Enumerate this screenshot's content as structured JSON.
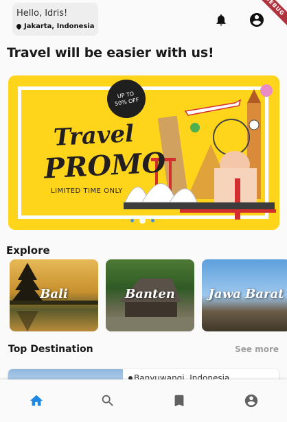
{
  "header": {
    "greeting": "Hello, Idris!",
    "location": "Jakarta, Indonesia",
    "notification_icon": "bell-icon",
    "profile_icon": "account-circle-icon",
    "debug_banner": "DEBUG"
  },
  "headline": "Travel will be easier with us!",
  "banner": {
    "badge_line1": "UP TO",
    "badge_line2": "50% OFF",
    "title_line1": "Travel",
    "title_line2": "PROMO",
    "subtitle": "LIMITED TIME ONLY",
    "slide_count": 3,
    "active_slide": 2
  },
  "explore": {
    "title": "Explore",
    "items": [
      {
        "label": "Bali"
      },
      {
        "label": "Banten"
      },
      {
        "label": "Jawa Barat"
      }
    ]
  },
  "top_destination": {
    "title": "Top Destination",
    "see_more": "See more",
    "items": [
      {
        "location": "Banyuwangi, Indonesia"
      }
    ]
  },
  "bottom_nav": {
    "items": [
      {
        "icon": "home-icon",
        "active": true
      },
      {
        "icon": "search-icon",
        "active": false
      },
      {
        "icon": "bookmark-icon",
        "active": false
      },
      {
        "icon": "account-icon",
        "active": false
      }
    ],
    "active_color": "#1e88e5",
    "inactive_color": "#616161"
  }
}
